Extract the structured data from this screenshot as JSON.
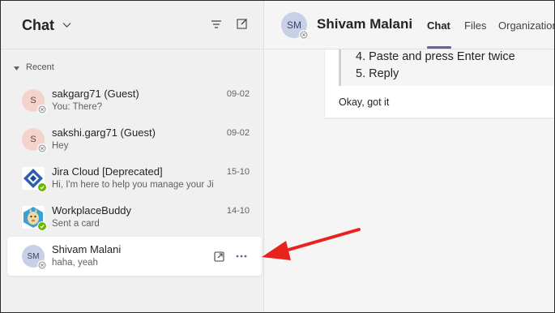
{
  "sidebar": {
    "title": "Chat",
    "section_label": "Recent",
    "items": [
      {
        "initials": "S",
        "name": "sakgarg71 (Guest)",
        "preview": "You: There?",
        "date": "09-02",
        "avatar_kind": "pink",
        "presence": "offline"
      },
      {
        "initials": "S",
        "name": "sakshi.garg71 (Guest)",
        "preview": "Hey",
        "date": "09-02",
        "avatar_kind": "pink",
        "presence": "offline"
      },
      {
        "initials": "",
        "name": "Jira Cloud [Deprecated]",
        "preview": "Hi, I'm here to help you manage your Jir...",
        "date": "15-10",
        "avatar_kind": "jira",
        "presence": "available"
      },
      {
        "initials": "",
        "name": "WorkplaceBuddy",
        "preview": "Sent a card",
        "date": "14-10",
        "avatar_kind": "workplacebuddy",
        "presence": "available"
      },
      {
        "initials": "SM",
        "name": "Shivam Malani",
        "preview": "haha, yeah",
        "date": "",
        "avatar_kind": "initials",
        "presence": "offline",
        "selected": true
      }
    ]
  },
  "conversation": {
    "initials": "SM",
    "name": "Shivam Malani",
    "tabs": [
      {
        "label": "Chat",
        "active": true
      },
      {
        "label": "Files",
        "active": false
      },
      {
        "label": "Organization",
        "active": false
      }
    ],
    "quoted_steps": [
      "4. Paste and press Enter twice",
      "5. Reply"
    ],
    "message": "Okay, got it"
  },
  "colors": {
    "accent": "#6264a7",
    "presence_available": "#6bb700",
    "annotation_arrow": "#e8231e"
  }
}
